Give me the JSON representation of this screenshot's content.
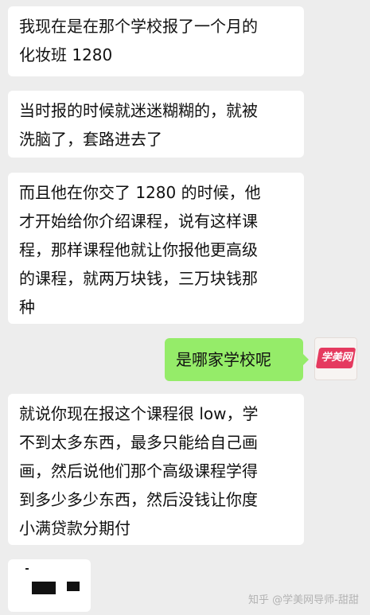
{
  "messages": [
    {
      "side": "received",
      "lines": [
        "我现在是在那个学校报了一个月的",
        "化妆班 1280"
      ]
    },
    {
      "side": "received",
      "lines": [
        "当时报的时候就迷迷糊糊的，就被",
        "洗脑了，套路进去了"
      ]
    },
    {
      "side": "received",
      "lines": [
        "而且他在你交了 1280 的时候，他",
        "才开始给你介绍课程，说有这样课",
        "程，那样课程他就让你报他更高级",
        "的课程，就两万块钱，三万块钱那",
        "种"
      ]
    },
    {
      "side": "sent",
      "text": "是哪家学校呢"
    },
    {
      "side": "received",
      "lines": [
        "就说你现在报这个课程很 low，学",
        "不到太多东西，最多只能给自己画",
        "画，然后说他们那个高级课程学得",
        "到多少多少东西，然后没钱让你度",
        "小满贷款分期付"
      ]
    }
  ],
  "avatar": {
    "logo_text": "学美网",
    "icon": "xuemeiwang-logo-icon",
    "brand_color": "#e53a5f"
  },
  "watermark": "知乎 @学美网导师-甜甜",
  "colors": {
    "background": "#ededed",
    "received_bubble": "#ffffff",
    "sent_bubble": "#95ec69"
  }
}
